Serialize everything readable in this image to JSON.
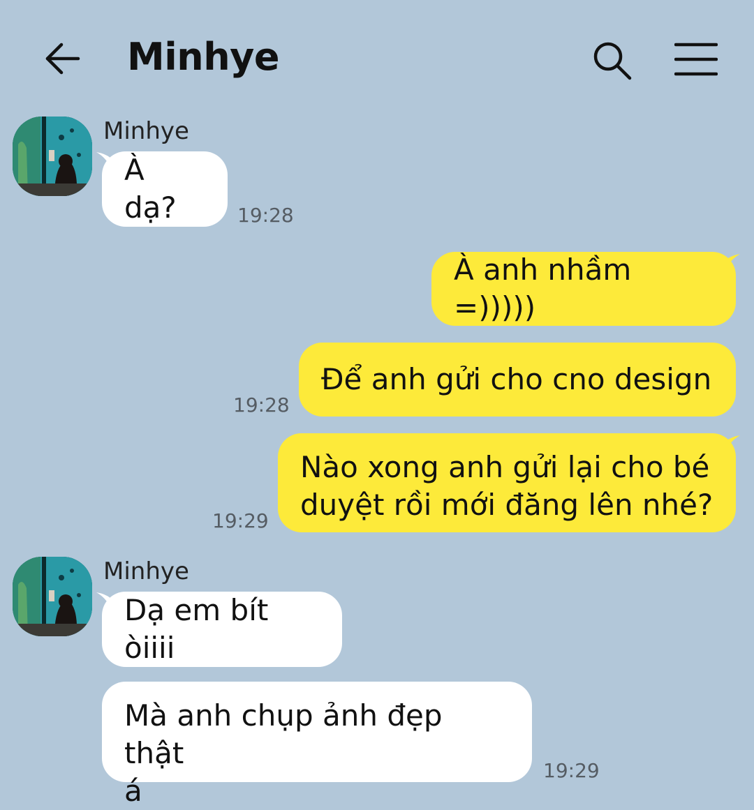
{
  "header": {
    "title": "Minhye",
    "back_icon": "arrow-left-icon",
    "search_icon": "search-icon",
    "menu_icon": "hamburger-menu-icon"
  },
  "colors": {
    "background": "#b2c7d9",
    "incoming_bubble": "#ffffff",
    "outgoing_bubble": "#fdea3a"
  },
  "messages": [
    {
      "direction": "in",
      "sender": "Minhye",
      "text": "À dạ?",
      "time": "19:28"
    },
    {
      "direction": "out",
      "text": "À anh nhầm =)))))",
      "time": ""
    },
    {
      "direction": "out",
      "text": "Để anh gửi cho cno design",
      "time": "19:28"
    },
    {
      "direction": "out",
      "text_lines": [
        "Nào xong anh gửi lại cho bé",
        "duyệt rồi mới đăng lên nhé?"
      ],
      "time": "19:29"
    },
    {
      "direction": "in",
      "sender": "Minhye",
      "text": "Dạ em bít òiiii",
      "time": ""
    },
    {
      "direction": "in",
      "text_lines": [
        "Mà anh chụp ảnh đẹp thật",
        "á"
      ],
      "time": "19:29"
    }
  ]
}
